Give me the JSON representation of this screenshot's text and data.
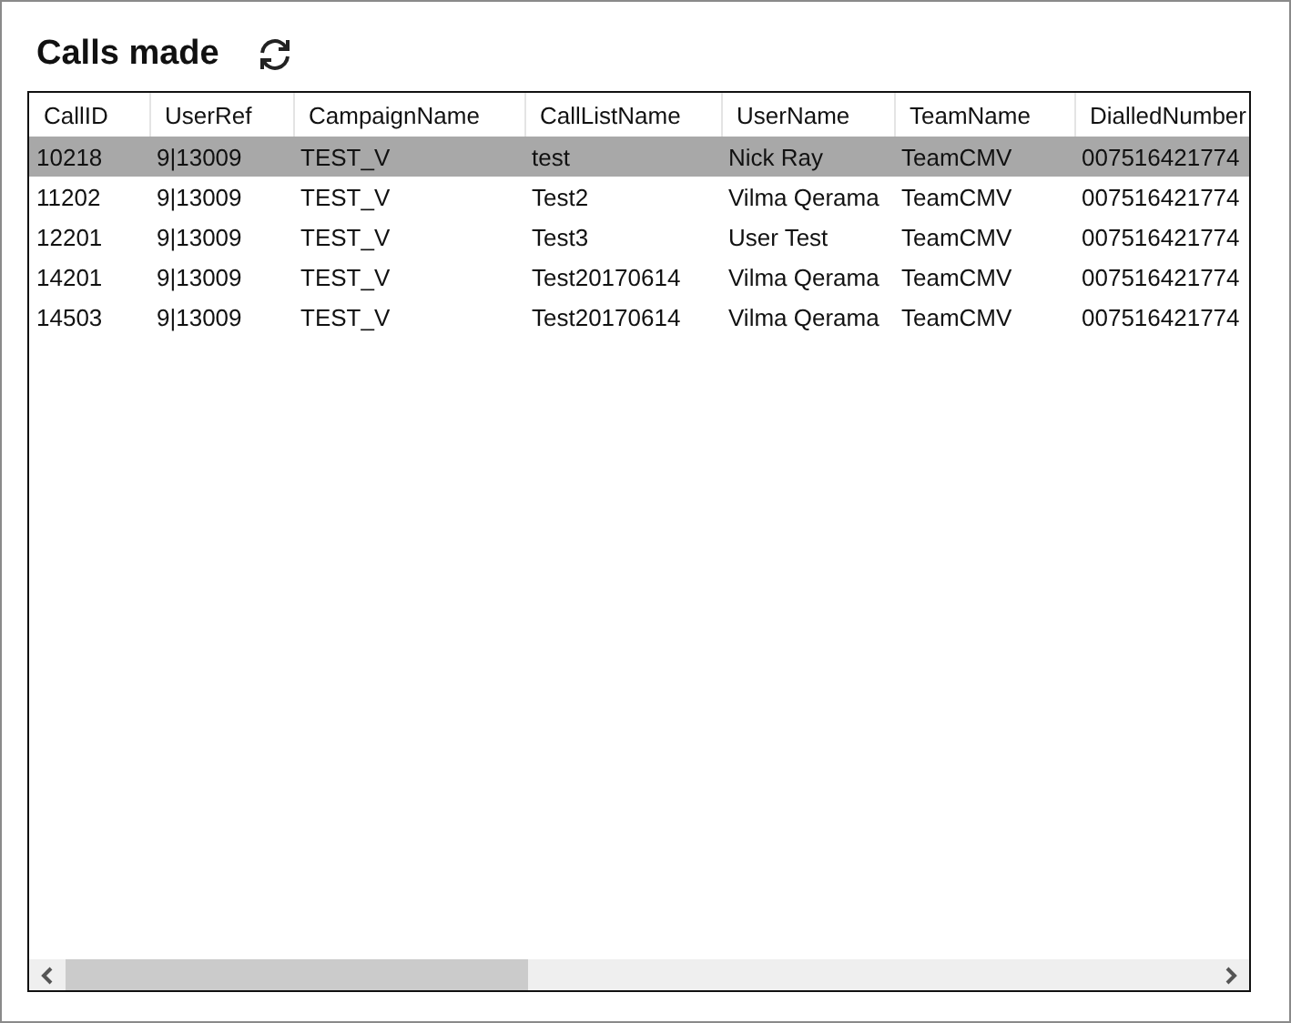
{
  "title": "Calls made",
  "table": {
    "columns": [
      "CallID",
      "UserRef",
      "CampaignName",
      "CallListName",
      "UserName",
      "TeamName",
      "DialledNumber"
    ],
    "rows": [
      {
        "selected": true,
        "cells": [
          "10218",
          "9|13009",
          "TEST_V",
          "test",
          "Nick Ray",
          "TeamCMV",
          "007516421774"
        ]
      },
      {
        "selected": false,
        "cells": [
          "11202",
          "9|13009",
          "TEST_V",
          "Test2",
          "Vilma Qerama",
          "TeamCMV",
          "007516421774"
        ]
      },
      {
        "selected": false,
        "cells": [
          "12201",
          "9|13009",
          "TEST_V",
          "Test3",
          "User Test",
          "TeamCMV",
          "007516421774"
        ]
      },
      {
        "selected": false,
        "cells": [
          "14201",
          "9|13009",
          "TEST_V",
          "Test20170614",
          "Vilma Qerama",
          "TeamCMV",
          "007516421774"
        ]
      },
      {
        "selected": false,
        "cells": [
          "14503",
          "9|13009",
          "TEST_V",
          "Test20170614",
          "Vilma Qerama",
          "TeamCMV",
          "007516421774"
        ]
      }
    ]
  }
}
